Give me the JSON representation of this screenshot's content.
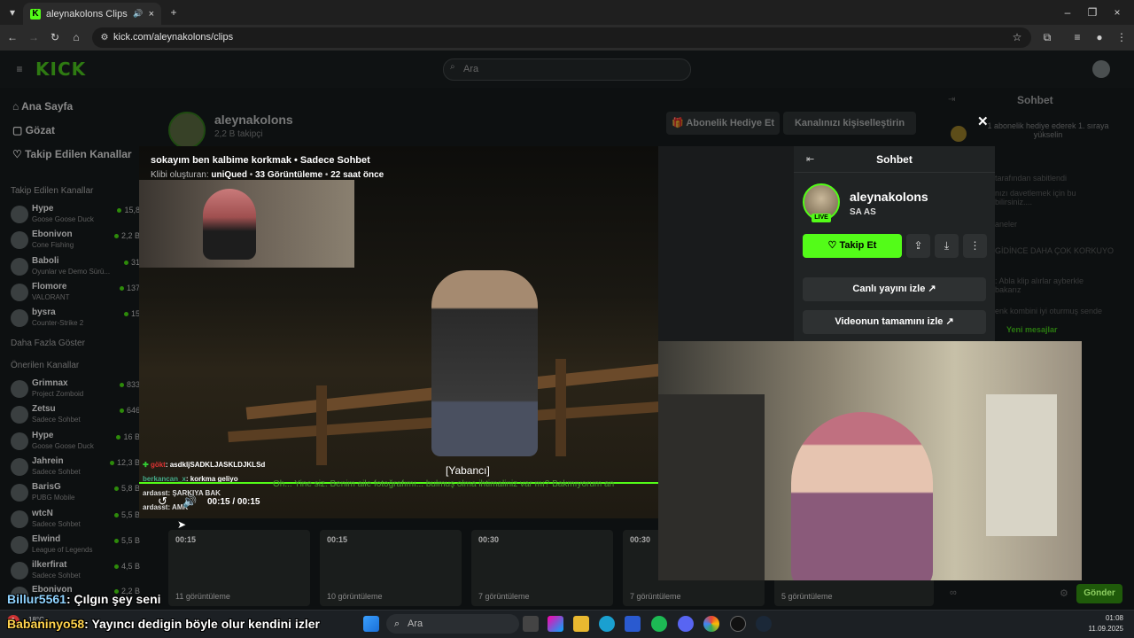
{
  "browser": {
    "tab_title": "aleynakolons Clips - Watch",
    "tab_favicon": "K",
    "url": "kick.com/aleynakolons/clips"
  },
  "nav": {
    "logo": "KICK",
    "search_placeholder": "Ara"
  },
  "sidebar": {
    "links": [
      "Ana Sayfa",
      "Gözat",
      "Takip Edilen Kanallar"
    ],
    "followed_header": "Takip Edilen Kanallar",
    "followed": [
      {
        "name": "Hype",
        "sub": "Goose Goose Duck",
        "viewers": "15,8"
      },
      {
        "name": "Ebonivon",
        "sub": "Cone Fishing",
        "viewers": "2,2 B"
      },
      {
        "name": "Baboli",
        "sub": "Oyunlar ve Demo Sürü...",
        "viewers": "31"
      },
      {
        "name": "Flomore",
        "sub": "VALORANT",
        "viewers": "137"
      },
      {
        "name": "bysra",
        "sub": "Counter-Strike 2",
        "viewers": "15"
      }
    ],
    "show_more": "Daha Fazla Göster",
    "recommended_header": "Önerilen Kanallar",
    "recommended": [
      {
        "name": "Grimnax",
        "sub": "Project Zomboid",
        "viewers": "833"
      },
      {
        "name": "Zetsu",
        "sub": "Sadece Sohbet",
        "viewers": "646"
      },
      {
        "name": "Hype",
        "sub": "Goose Goose Duck",
        "viewers": "16 B"
      },
      {
        "name": "Jahrein",
        "sub": "Sadece Sohbet",
        "viewers": "12,3 B"
      },
      {
        "name": "BarisG",
        "sub": "PUBG Mobile",
        "viewers": "5,8 B"
      },
      {
        "name": "wtcN",
        "sub": "Sadece Sohbet",
        "viewers": "5,5 B"
      },
      {
        "name": "Elwind",
        "sub": "League of Legends",
        "viewers": "5,5 B"
      },
      {
        "name": "ilkerfirat",
        "sub": "Sadece Sohbet",
        "viewers": "4,5 B"
      },
      {
        "name": "Ebonivon",
        "sub": "",
        "viewers": "2,2 B"
      }
    ]
  },
  "channel": {
    "name": "aleynakolons",
    "followers": "2,2 B takipçi",
    "gift_sub": "Abonelik Hediye Et",
    "customize": "Kanalınızı kişiselleştirin"
  },
  "clip": {
    "title": "sokayım ben kalbime korkmak • Sadece Sohbet",
    "meta_prefix": "Klibi oluşturan: ",
    "creator": "uniQued",
    "views": "33 Görüntüleme",
    "age": "22 saat önce",
    "time": "00:15 / 00:15",
    "subtitle_speaker": "[Yabancı]",
    "subtitle_text": "Oh... Yine siz. Benim aile fotoğrafımı... bulmuş olma ihtimaliniz var mı? Bakmıyorum an"
  },
  "overlay_chat": [
    {
      "user": "gökt",
      "text": ": asdkljSADKLJASKLDJKLSd"
    },
    {
      "user": "berkancan_x",
      "text": ": korkma geliyo"
    },
    {
      "user": "ardasst",
      "text": ": ŞARKIYA BAK"
    },
    {
      "user": "ardasst",
      "text": ": AMK"
    }
  ],
  "panel": {
    "title": "Sohbet",
    "channel_name": "aleynakolons",
    "tagline": "SA AS",
    "live_label": "LIVE",
    "follow_label": "Takip Et",
    "watch_live": "Canlı yayını izle",
    "watch_full": "Videonun tamamını izle"
  },
  "right_chat": {
    "title": "Sohbet",
    "gift_note": "1 abonelik hediye ederek 1. sıraya yükselin",
    "pinned": "tarafından sabitlendi",
    "lines": [
      "nızı davetlemek için bu bilirsiniz....",
      "aneler",
      "GİDİNCE DAHA ÇOK KORKUYO",
      ": Abla klip alırlar ayberkle bakarız",
      "enk kombini iyi oturmuş sende"
    ],
    "new_messages": "Yeni mesajlar",
    "send": "Gönder"
  },
  "thumbs": [
    {
      "duration": "00:15",
      "views": "11 görüntüleme"
    },
    {
      "duration": "00:15",
      "views": "10 görüntüleme"
    },
    {
      "duration": "00:30",
      "views": "7 görüntüleme"
    },
    {
      "duration": "00:30",
      "views": "7 görüntüleme"
    },
    {
      "duration": "",
      "views": "5 görüntüleme"
    }
  ],
  "stream_chat": [
    {
      "user": "Billur5561",
      "text": ": Çılgın şey seni",
      "color": "#8fd3ff"
    },
    {
      "user": "Babaninyo58",
      "text": ": Yayıncı dedigin böyle olur kendini izler",
      "color": "#ffd34d"
    }
  ],
  "taskbar": {
    "search": "Ara",
    "time": "01:08",
    "date": "11.09.2025",
    "temp": "18°C",
    "notif_count": "1"
  },
  "colors": {
    "kick_green": "#53fc18"
  }
}
